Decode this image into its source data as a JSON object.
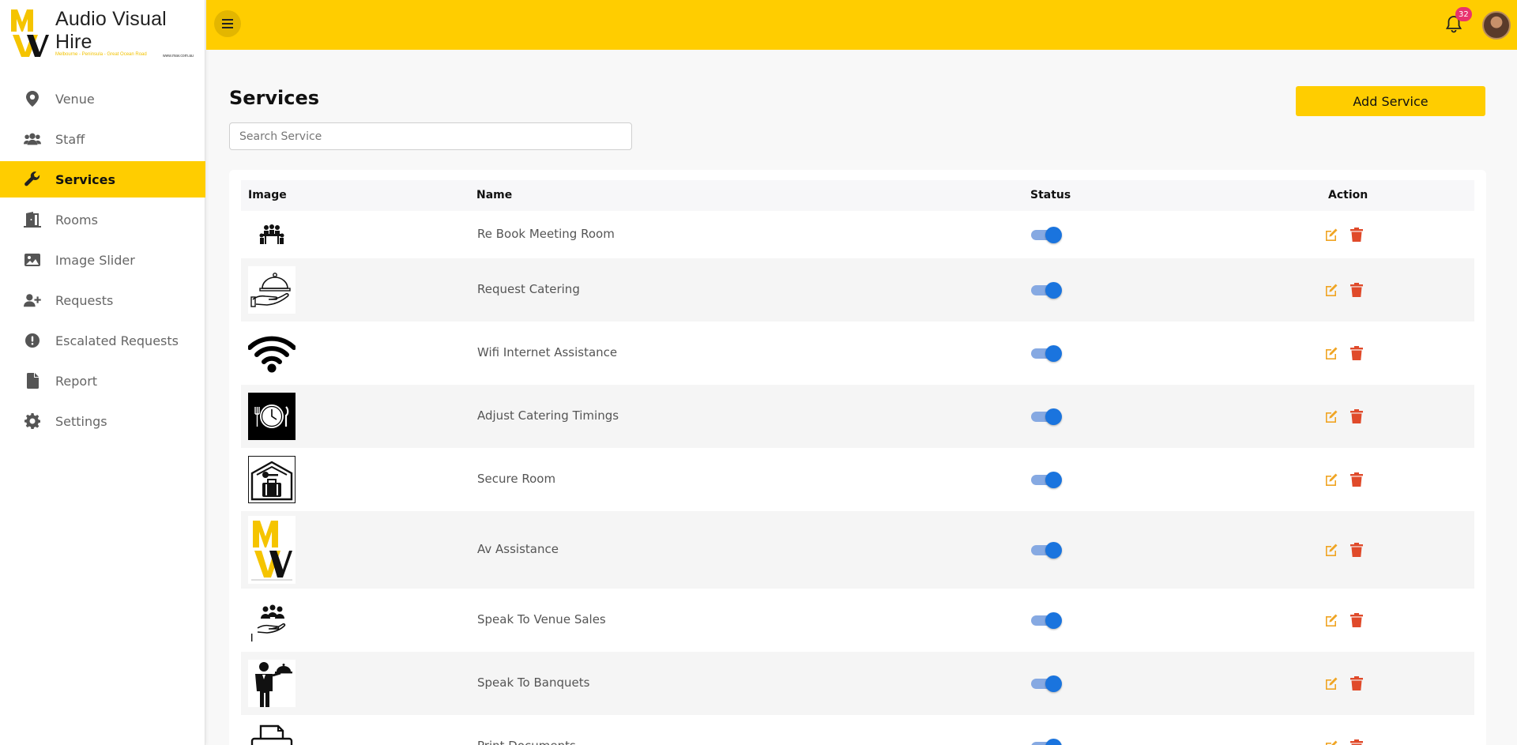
{
  "brand": {
    "name": "Audio Visual Hire",
    "tagline": "Melbourne - Peninsula - Great Ocean Road",
    "url": "www.mav.com.au"
  },
  "colors": {
    "accent": "#ffcd00",
    "badge": "#e8336e",
    "toggle_on": "#1a74de",
    "edit_icon": "#f0a524",
    "delete_icon": "#e04a2a"
  },
  "sidebar": {
    "items": [
      {
        "label": "Venue",
        "icon": "map-marker-icon",
        "active": false
      },
      {
        "label": "Staff",
        "icon": "users-icon",
        "active": false
      },
      {
        "label": "Services",
        "icon": "wrench-icon",
        "active": true
      },
      {
        "label": "Rooms",
        "icon": "door-icon",
        "active": false
      },
      {
        "label": "Image Slider",
        "icon": "image-icon",
        "active": false
      },
      {
        "label": "Requests",
        "icon": "user-plus-icon",
        "active": false
      },
      {
        "label": "Escalated Requests",
        "icon": "exclamation-circle-icon",
        "active": false
      },
      {
        "label": "Report",
        "icon": "file-icon",
        "active": false
      },
      {
        "label": "Settings",
        "icon": "gear-icon",
        "active": false
      }
    ]
  },
  "topbar": {
    "menu_icon": "hamburger-icon",
    "notification_icon": "bell-icon",
    "notification_count": "32"
  },
  "main": {
    "title": "Services",
    "add_button_label": "Add Service",
    "search": {
      "placeholder": "Search Service",
      "value": ""
    },
    "table": {
      "headers": {
        "image": "Image",
        "name": "Name",
        "status": "Status",
        "action": "Action"
      },
      "rows": [
        {
          "name": "Re Book Meeting Room",
          "image_icon": "meeting-room-icon",
          "status": "on"
        },
        {
          "name": "Request Catering",
          "image_icon": "catering-cloche-icon",
          "status": "on"
        },
        {
          "name": "Wifi Internet Assistance",
          "image_icon": "wifi-icon",
          "status": "on"
        },
        {
          "name": "Adjust Catering Timings",
          "image_icon": "catering-timer-icon",
          "status": "on"
        },
        {
          "name": "Secure Room",
          "image_icon": "secure-room-icon",
          "status": "on"
        },
        {
          "name": "Av Assistance",
          "image_icon": "mav-logo-icon",
          "status": "on"
        },
        {
          "name": "Speak To Venue Sales",
          "image_icon": "venue-sales-icon",
          "status": "on"
        },
        {
          "name": "Speak To Banquets",
          "image_icon": "waiter-icon",
          "status": "on"
        },
        {
          "name": "Print Documents",
          "image_icon": "printer-icon",
          "status": "on"
        }
      ]
    }
  }
}
